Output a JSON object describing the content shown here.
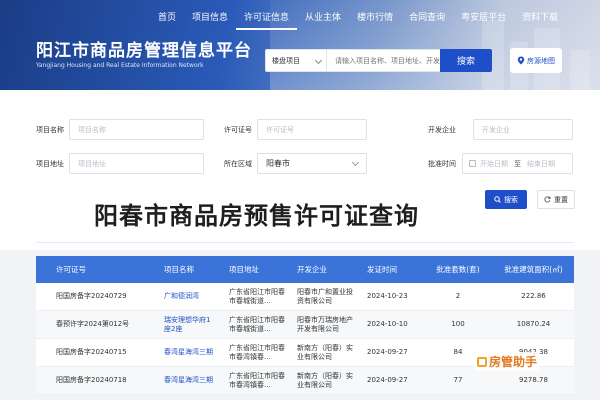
{
  "nav": [
    "首页",
    "项目信息",
    "许可证信息",
    "从业主体",
    "楼市行情",
    "合同查询",
    "粤安居平台",
    "资料下载"
  ],
  "nav_active": 2,
  "brand": {
    "title": "阳江市商品房管理信息平台",
    "subtitle": "Yangjiang Housing and Real Estate Information Network"
  },
  "search": {
    "select_value": "楼盘项目",
    "placeholder": "请输入项目名称、项目地址、开发",
    "button": "搜索",
    "map_button": "房源地图"
  },
  "filters": {
    "project_name_label": "项目名称",
    "project_name_placeholder": "项目名称",
    "license_label": "许可证号",
    "license_placeholder": "许可证号",
    "developer_label": "开发企业",
    "developer_placeholder": "开发企业",
    "address_label": "项目地址",
    "address_placeholder": "项目地址",
    "region_label": "所在区域",
    "region_value": "阳春市",
    "approve_label": "批准时间",
    "start_placeholder": "开始日期",
    "to": "至",
    "end_placeholder": "结束日期",
    "search_button": "搜索",
    "reset_button": "重置"
  },
  "page_title": "阳春市商品房预售许可证查询",
  "table": {
    "headers": [
      "许可证号",
      "项目名称",
      "项目地址",
      "开发企业",
      "发证时间",
      "批准套数(套)",
      "批准建筑面积(㎡)"
    ],
    "rows": [
      [
        "阳国房备字20240729",
        "广和德润湾",
        "广东省阳江市阳春市春城街道…",
        "阳春市广和置业投资有限公司",
        "2024-10-23",
        "2",
        "222.86"
      ],
      [
        "春预许字2024第012号",
        "瑞安理想华府1座2座",
        "广东省阳江市阳春市春城街道…",
        "阳春市万瑞房地产开发有限公司",
        "2024-10-10",
        "100",
        "10870.24"
      ],
      [
        "阳国房备字20240715",
        "春湾星海湾三期",
        "广东省阳江市阳春市春湾镇春…",
        "新南方（阳春）实业有限公司",
        "2024-09-27",
        "84",
        "9042.38"
      ],
      [
        "阳国房备字20240718",
        "春湾星海湾三期",
        "广东省阳江市阳春市春湾镇春…",
        "新南方（阳春）实业有限公司",
        "2024-09-27",
        "77",
        "9278.78"
      ]
    ]
  },
  "watermark": "房管助手",
  "colors": {
    "primary": "#1f4fc8",
    "table_header": "#3b73d9",
    "watermark": "#e6781f"
  }
}
